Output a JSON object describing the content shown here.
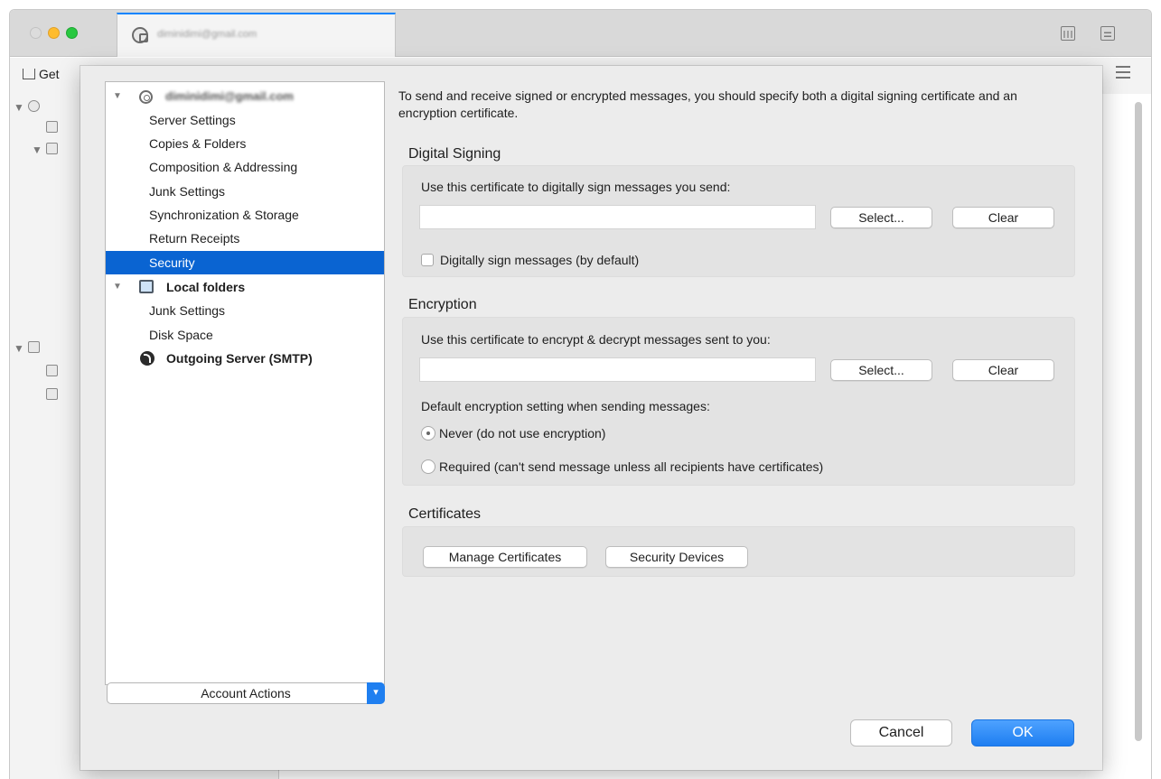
{
  "window": {
    "tab_title": "diminidimi@gmail.com",
    "toolbar": {
      "get_messages": "Get"
    }
  },
  "tree": {
    "account_name": "diminidimi@gmail.com",
    "account_items": [
      "Server Settings",
      "Copies & Folders",
      "Composition & Addressing",
      "Junk Settings",
      "Synchronization & Storage",
      "Return Receipts",
      "Security"
    ],
    "selected_item": "Security",
    "local_folders": {
      "label": "Local folders",
      "items": [
        "Junk Settings",
        "Disk Space"
      ]
    },
    "outgoing_server": "Outgoing Server (SMTP)"
  },
  "account_actions": {
    "label": "Account Actions"
  },
  "security": {
    "intro": "To send and receive signed or encrypted messages, you should specify both a digital signing certificate and an encryption certificate.",
    "signing": {
      "title": "Digital Signing",
      "label": "Use this certificate to digitally sign messages you send:",
      "value": "",
      "select_label": "Select...",
      "clear_label": "Clear",
      "checkbox_label": "Digitally sign messages (by default)",
      "checkbox_checked": false
    },
    "encryption": {
      "title": "Encryption",
      "label": "Use this certificate to encrypt & decrypt messages sent to you:",
      "value": "",
      "select_label": "Select...",
      "clear_label": "Clear",
      "default_label": "Default encryption setting when sending messages:",
      "options": [
        {
          "label": "Never (do not use encryption)",
          "selected": true
        },
        {
          "label": "Required (can't send message unless all recipients have certificates)",
          "selected": false
        }
      ]
    },
    "certificates": {
      "title": "Certificates",
      "manage_label": "Manage Certificates",
      "devices_label": "Security Devices"
    }
  },
  "dialog_buttons": {
    "cancel": "Cancel",
    "ok": "OK"
  },
  "colors": {
    "selection": "#0a64d2",
    "accent": "#1e7ef1",
    "tab_indicator": "#0a84ff"
  }
}
